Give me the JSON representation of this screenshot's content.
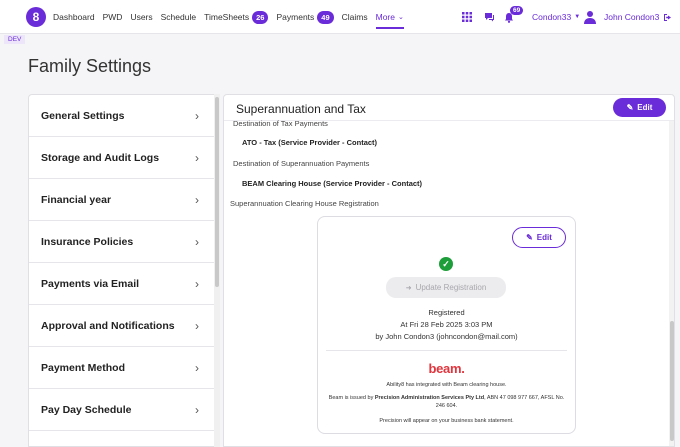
{
  "nav": {
    "items": [
      {
        "label": "Dashboard"
      },
      {
        "label": "PWD"
      },
      {
        "label": "Users"
      },
      {
        "label": "Schedule"
      },
      {
        "label": "TimeSheets",
        "badge": "26"
      },
      {
        "label": "Payments",
        "badge": "49"
      },
      {
        "label": "Claims"
      },
      {
        "label": "More",
        "active": true
      }
    ],
    "notifications_count": "69",
    "org": "Condon33",
    "user": "John Condon3"
  },
  "env_badge": "DEV",
  "page_title": "Family Settings",
  "menu": [
    "General Settings",
    "Storage and Audit Logs",
    "Financial year",
    "Insurance Policies",
    "Payments via Email",
    "Approval and Notifications",
    "Payment Method",
    "Pay Day Schedule"
  ],
  "panel": {
    "title": "Superannuation and Tax",
    "edit_label": "Edit",
    "tax_dest_label": "Destination of Tax Payments",
    "tax_dest_value": "ATO - Tax (Service Provider - Contact)",
    "super_dest_label": "Destination of Superannuation Payments",
    "super_dest_value": "BEAM Clearing House (Service Provider - Contact)",
    "clearing_label": "Superannuation Clearing House Registration"
  },
  "card": {
    "edit_label": "Edit",
    "update_label": "Update Registration",
    "status": "Registered",
    "date_line": "At Fri 28 Feb 2025 3:03 PM",
    "by_line": "by John Condon3 (johncondon@mail.com)",
    "brand": "beam.",
    "integration_text": "Ability8 has integrated with Beam clearing house.",
    "issued_prefix": "Beam is issued by ",
    "issued_company": "Precision Administration Services Pty Ltd",
    "issued_suffix": ", ABN 47 098 977 667, AFSL No. 246 604.",
    "statement_text": "Precision will appear on your business bank statement."
  },
  "colors": {
    "brand_purple": "#6a2bd8",
    "success_green": "#1e9e3a",
    "beam_red": "#e2343c"
  }
}
